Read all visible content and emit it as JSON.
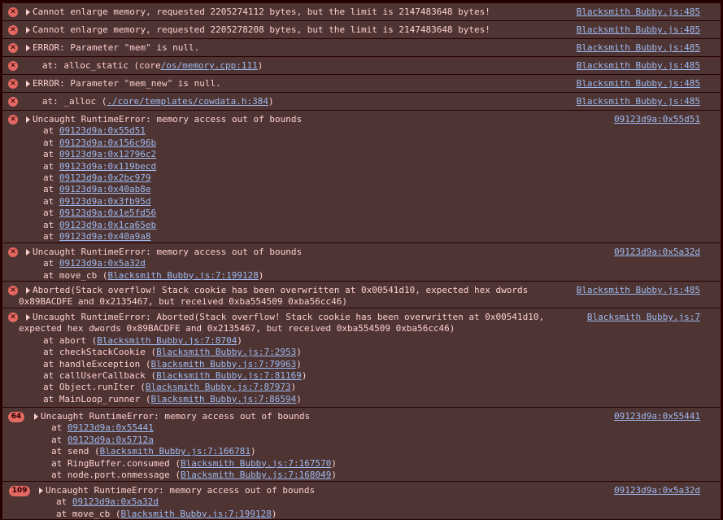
{
  "messages": [
    {
      "text": "Cannot enlarge memory, requested 2205274112 bytes, but the limit is 2147483648 bytes!",
      "source": "Blacksmith Bubby.js:485"
    },
    {
      "text": "Cannot enlarge memory, requested 2205278208 bytes, but the limit is 2147483648 bytes!",
      "source": "Blacksmith Bubby.js:485"
    },
    {
      "text": "ERROR: Parameter \"mem\" is null.",
      "source": "Blacksmith Bubby.js:485"
    },
    {
      "prefix": "   at: alloc_static (core",
      "link": "/os/memory.cpp:111",
      "suffix": ")",
      "source": "Blacksmith Bubby.js:485"
    },
    {
      "text": "ERROR: Parameter \"mem_new\" is null.",
      "source": "Blacksmith Bubby.js:485"
    },
    {
      "prefix": "   at: _alloc (",
      "link": "./core/templates/cowdata.h:384",
      "suffix": ")",
      "source": "Blacksmith Bubby.js:485"
    },
    {
      "text": "Uncaught RuntimeError: memory access out of bounds",
      "source": "09123d9a:0x55d51",
      "frames": [
        {
          "prefix": "at ",
          "link": "09123d9a:0x55d51",
          "suffix": ""
        },
        {
          "prefix": "at ",
          "link": "09123d9a:0x156c96b",
          "suffix": ""
        },
        {
          "prefix": "at ",
          "link": "09123d9a:0x12796c2",
          "suffix": ""
        },
        {
          "prefix": "at ",
          "link": "09123d9a:0x119becd",
          "suffix": ""
        },
        {
          "prefix": "at ",
          "link": "09123d9a:0x2bc979",
          "suffix": ""
        },
        {
          "prefix": "at ",
          "link": "09123d9a:0x40ab8e",
          "suffix": ""
        },
        {
          "prefix": "at ",
          "link": "09123d9a:0x3fb95d",
          "suffix": ""
        },
        {
          "prefix": "at ",
          "link": "09123d9a:0x1e5fd56",
          "suffix": ""
        },
        {
          "prefix": "at ",
          "link": "09123d9a:0x1ca65eb",
          "suffix": ""
        },
        {
          "prefix": "at ",
          "link": "09123d9a:0x40a9a8",
          "suffix": ""
        }
      ]
    },
    {
      "text": "Uncaught RuntimeError: memory access out of bounds",
      "source": "09123d9a:0x5a32d",
      "frames": [
        {
          "prefix": "at ",
          "link": "09123d9a:0x5a32d",
          "suffix": ""
        },
        {
          "prefix": "at move_cb (",
          "link": "Blacksmith Bubby.js:7:199128",
          "suffix": ")"
        }
      ]
    },
    {
      "text": "Aborted(Stack overflow! Stack cookie has been overwritten at 0x00541d10, expected hex dwords",
      "text2": "0x89BACDFE and 0x2135467, but received 0xba554509 0xba56cc46)",
      "source": "Blacksmith Bubby.js:485"
    },
    {
      "text": "Uncaught RuntimeError: Aborted(Stack overflow! Stack cookie has been overwritten at 0x00541d10,",
      "text2": "expected hex dwords 0x89BACDFE and 0x2135467, but received 0xba554509 0xba56cc46)",
      "source": "Blacksmith Bubby.js:7",
      "frames": [
        {
          "prefix": "at abort (",
          "link": "Blacksmith Bubby.js:7:8704",
          "suffix": ")"
        },
        {
          "prefix": "at checkStackCookie (",
          "link": "Blacksmith Bubby.js:7:2953",
          "suffix": ")"
        },
        {
          "prefix": "at handleException (",
          "link": "Blacksmith Bubby.js:7:79963",
          "suffix": ")"
        },
        {
          "prefix": "at callUserCallback (",
          "link": "Blacksmith Bubby.js:7:81169",
          "suffix": ")"
        },
        {
          "prefix": "at Object.runIter (",
          "link": "Blacksmith Bubby.js:7:87973",
          "suffix": ")"
        },
        {
          "prefix": "at MainLoop_runner (",
          "link": "Blacksmith Bubby.js:7:86594",
          "suffix": ")"
        }
      ]
    },
    {
      "count": "64",
      "text": "Uncaught RuntimeError: memory access out of bounds",
      "source": "09123d9a:0x55441",
      "frames": [
        {
          "prefix": "at ",
          "link": "09123d9a:0x55441",
          "suffix": ""
        },
        {
          "prefix": "at ",
          "link": "09123d9a:0x5712a",
          "suffix": ""
        },
        {
          "prefix": "at send (",
          "link": "Blacksmith Bubby.js:7:166781",
          "suffix": ")"
        },
        {
          "prefix": "at RingBuffer.consumed (",
          "link": "Blacksmith Bubby.js:7:167570",
          "suffix": ")"
        },
        {
          "prefix": "at node.port.onmessage (",
          "link": "Blacksmith Bubby.js:7:168049",
          "suffix": ")"
        }
      ]
    },
    {
      "count": "109",
      "text": "Uncaught RuntimeError: memory access out of bounds",
      "source": "09123d9a:0x5a32d",
      "frames": [
        {
          "prefix": "at ",
          "link": "09123d9a:0x5a32d",
          "suffix": ""
        },
        {
          "prefix": "at move_cb (",
          "link": "Blacksmith Bubby.js:7:199128",
          "suffix": ")"
        }
      ]
    }
  ]
}
